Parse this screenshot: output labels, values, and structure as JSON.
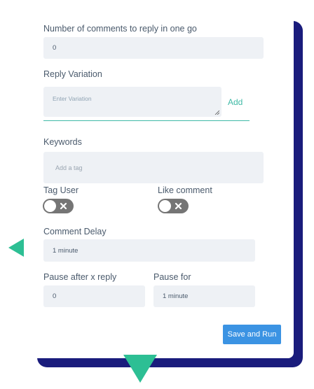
{
  "form": {
    "comments_count": {
      "label": "Number of comments to reply in one go",
      "value": "0"
    },
    "reply_variation": {
      "label": "Reply Variation",
      "placeholder": "Enter Variation",
      "add_label": "Add"
    },
    "keywords": {
      "label": "Keywords",
      "placeholder": "Add a tag"
    },
    "tag_user": {
      "label": "Tag User",
      "enabled": false
    },
    "like_comment": {
      "label": "Like comment",
      "enabled": false
    },
    "comment_delay": {
      "label": "Comment Delay",
      "value": "1 minute"
    },
    "pause_after": {
      "label": "Pause after x reply",
      "value": "0"
    },
    "pause_for": {
      "label": "Pause for",
      "value": "1 minute"
    },
    "submit_label": "Save and Run"
  },
  "colors": {
    "backdrop": "#1a1c7c",
    "accent_green": "#2dbf94",
    "teal": "#3fb9a6",
    "button": "#3b93e3",
    "field_bg": "#eef1f5",
    "toggle_off": "#757575"
  }
}
